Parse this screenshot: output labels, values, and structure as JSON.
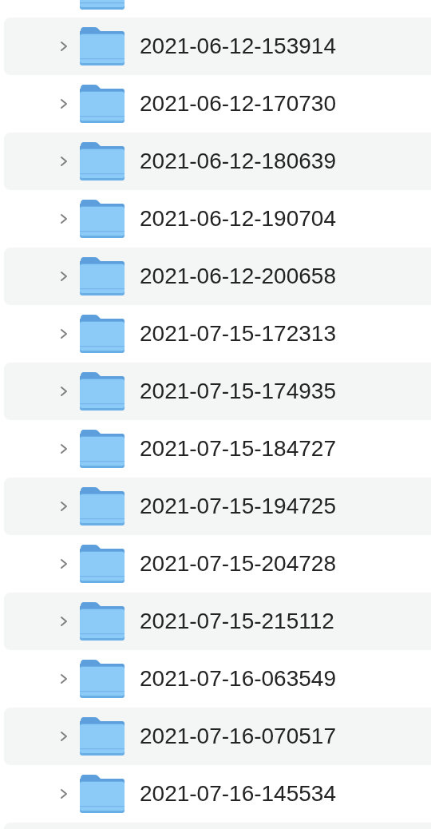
{
  "folders": [
    {
      "name": "2021-06-12-153914",
      "expanded": false
    },
    {
      "name": "2021-06-12-170730",
      "expanded": false
    },
    {
      "name": "2021-06-12-180639",
      "expanded": false
    },
    {
      "name": "2021-06-12-190704",
      "expanded": false
    },
    {
      "name": "2021-06-12-200658",
      "expanded": false
    },
    {
      "name": "2021-07-15-172313",
      "expanded": false
    },
    {
      "name": "2021-07-15-174935",
      "expanded": false
    },
    {
      "name": "2021-07-15-184727",
      "expanded": false
    },
    {
      "name": "2021-07-15-194725",
      "expanded": false
    },
    {
      "name": "2021-07-15-204728",
      "expanded": false
    },
    {
      "name": "2021-07-15-215112",
      "expanded": false
    },
    {
      "name": "2021-07-16-063549",
      "expanded": false
    },
    {
      "name": "2021-07-16-070517",
      "expanded": false
    },
    {
      "name": "2021-07-16-145534",
      "expanded": false
    }
  ]
}
